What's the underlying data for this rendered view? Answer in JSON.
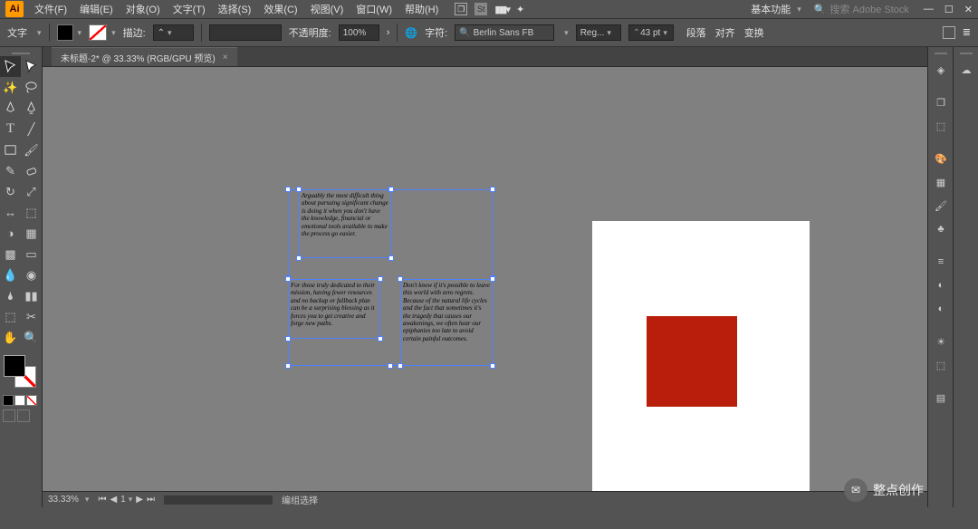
{
  "app": {
    "logo": "Ai"
  },
  "menus": {
    "file": "文件(F)",
    "edit": "编辑(E)",
    "object": "对象(O)",
    "type": "文字(T)",
    "select": "选择(S)",
    "effect": "效果(C)",
    "view": "视图(V)",
    "window": "窗口(W)",
    "help": "帮助(H)"
  },
  "workspace": {
    "name": "基本功能"
  },
  "search": {
    "placeholder": "搜索 Adobe Stock"
  },
  "options": {
    "tool_label": "文字",
    "stroke_label": "描边:",
    "opacity_label": "不透明度:",
    "opacity_value": "100%",
    "char_label": "字符:",
    "font_name": "Berlin Sans FB",
    "font_style": "Reg...",
    "font_size": "43 pt",
    "para": "段落",
    "align": "对齐",
    "transform": "变换"
  },
  "tab": {
    "title": "未标题-2* @ 33.33% (RGB/GPU 预览)"
  },
  "texts": {
    "t1": "Arguably the most difficult thing about pursuing significant change is doing it when you don't have the knowledge, financial or emotional tools available to make the process go easier.",
    "t2": "For those truly dedicated to their mission, having fewer resources and no backup or fallback plan can be a surprising blessing as it forces you to get creative and forge new paths.",
    "t3": "Don't know if it's possible to leave this world with zero regrets. Because of the natural life cycles and the fact that sometimes it's the tragedy that causes our awakenings, we often hear our epiphanies too late to avoid certain painful outcomes."
  },
  "status": {
    "zoom": "33.33%",
    "nav": "1",
    "selection": "编组选择"
  },
  "watermark": {
    "text": "整点创作"
  }
}
